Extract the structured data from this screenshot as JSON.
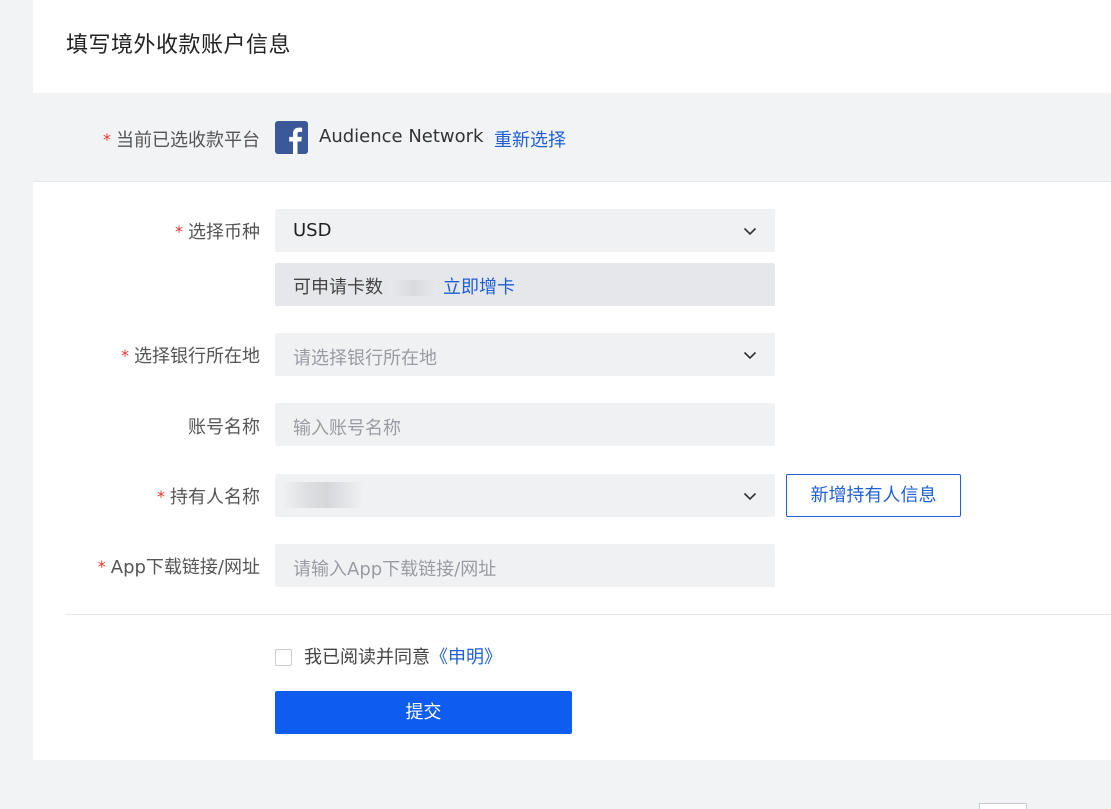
{
  "page": {
    "title": "填写境外收款账户信息"
  },
  "platform": {
    "label": "当前已选收款平台",
    "name": "Audience Network",
    "reselect_link": "重新选择",
    "icon": "facebook-icon"
  },
  "currency": {
    "label": "选择币种",
    "value": "USD",
    "card_info_prefix": "可申请卡数",
    "apply_link": "立即增卡"
  },
  "bank_location": {
    "label": "选择银行所在地",
    "placeholder": "请选择银行所在地"
  },
  "account_name": {
    "label": "账号名称",
    "placeholder": "输入账号名称"
  },
  "holder_name": {
    "label": "持有人名称",
    "add_button": "新增持有人信息"
  },
  "app_link": {
    "label": "App下载链接/网址",
    "placeholder": "请输入App下载链接/网址"
  },
  "agreement": {
    "text": "我已阅读并同意",
    "link": "《申明》",
    "checked": false
  },
  "submit_label": "提交",
  "required_mark": "*",
  "colors": {
    "accent": "#0f5cf0",
    "link": "#1f5fd6",
    "required": "#e5342f",
    "facebook": "#3b5998"
  }
}
